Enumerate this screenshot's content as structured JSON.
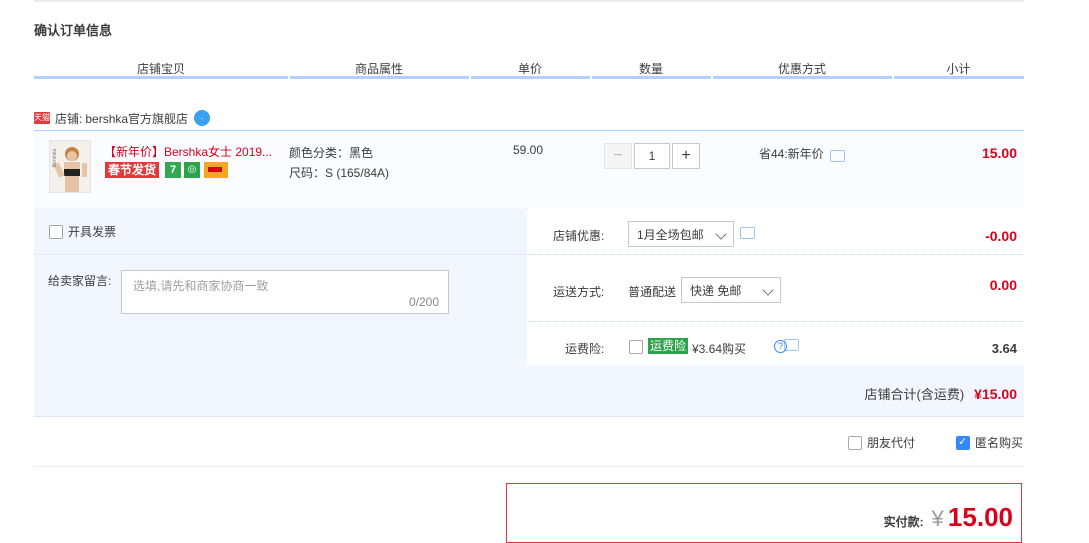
{
  "page_title": "确认订单信息",
  "columns": [
    "店铺宝贝",
    "商品属性",
    "单价",
    "数量",
    "优惠方式",
    "小计"
  ],
  "shop": {
    "tmall_badge": "天猫",
    "label": "店铺:",
    "name": "bershka官方旗舰店"
  },
  "item": {
    "thumb_brand": "Bershka",
    "title": "【新年价】Bershka女士 2019...",
    "tag_spring": "春节发货",
    "tag_seven": "7",
    "attributes": [
      "颜色分类：黑色",
      "尺码：S (165/84A)"
    ],
    "unit_price": "59.00",
    "qty_minus": "−",
    "quantity": "1",
    "qty_plus": "+",
    "discount_text": "省44:新年价",
    "subtotal": "15.00"
  },
  "invoice": {
    "label": "开具发票",
    "checked": false
  },
  "note": {
    "label": "给卖家留言:",
    "placeholder": "选填,请先和商家协商一致",
    "counter": "0/200"
  },
  "shop_discount": {
    "label": "店铺优惠:",
    "selected": "1月全场包邮",
    "amount": "-0.00"
  },
  "shipping": {
    "label": "运送方式:",
    "type_label": "普通配送",
    "selected": "快递 免邮",
    "amount": "0.00"
  },
  "insurance": {
    "label": "运费险:",
    "badge": "运费险",
    "text": "¥3.64购买",
    "amount": "3.64",
    "checked": false
  },
  "shop_total": {
    "label": "店铺合计(含运费)",
    "amount": "¥15.00"
  },
  "options": {
    "friend_pay": "朋友代付",
    "friend_pay_checked": false,
    "anonymous": "匿名购买",
    "anonymous_checked": true
  },
  "payment": {
    "label": "实付款:",
    "currency": "¥",
    "amount": "15.00"
  },
  "colors": {
    "accent_red": "#d8001b",
    "header_bar": "#b2d1ff",
    "panel_bg": "#f2f7ff",
    "check_blue": "#3388ff"
  }
}
